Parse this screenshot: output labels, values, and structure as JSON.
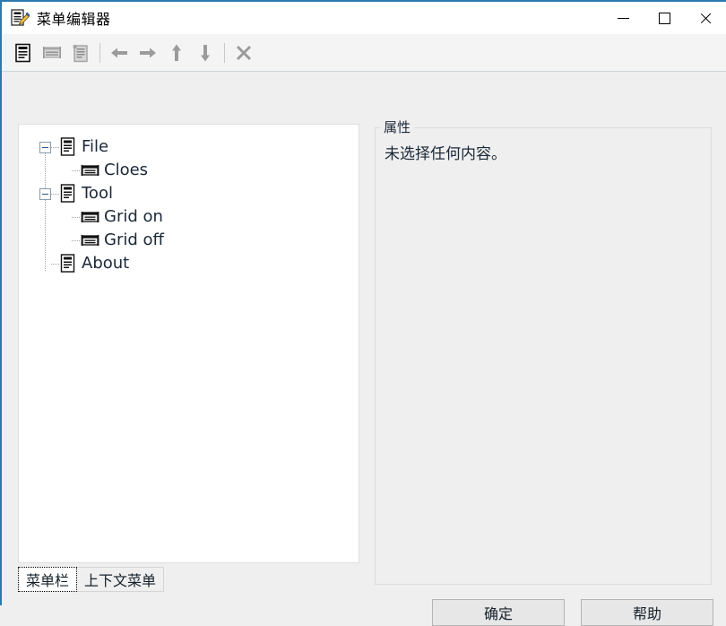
{
  "window": {
    "title": "菜单编辑器",
    "icon": "menu-editor-document-pencil-icon",
    "accent_border_color": "#2a7ab0",
    "controls": {
      "minimize": "—",
      "maximize": "□",
      "close": "✕"
    }
  },
  "toolbar": {
    "items": [
      {
        "name": "new-menu-item-button",
        "icon": "document-lines-icon",
        "enabled": true
      },
      {
        "name": "new-separator-button",
        "icon": "separator-icon",
        "enabled": false
      },
      {
        "name": "new-submenu-button",
        "icon": "document-star-icon",
        "enabled": false
      },
      {
        "name": "move-left-button",
        "icon": "arrow-left-icon",
        "enabled": false
      },
      {
        "name": "move-right-button",
        "icon": "arrow-right-icon",
        "enabled": false
      },
      {
        "name": "move-up-button",
        "icon": "arrow-up-icon",
        "enabled": false
      },
      {
        "name": "move-down-button",
        "icon": "arrow-down-icon",
        "enabled": false
      },
      {
        "name": "delete-button",
        "icon": "close-x-icon",
        "enabled": false
      }
    ]
  },
  "tree": {
    "nodes": [
      {
        "label": "File",
        "level": 0,
        "expandable": true,
        "expanded": true,
        "icon": "menu-document-icon"
      },
      {
        "label": "Cloes",
        "level": 1,
        "expandable": false,
        "expanded": false,
        "icon": "menu-item-bar-icon"
      },
      {
        "label": "Tool",
        "level": 0,
        "expandable": true,
        "expanded": true,
        "icon": "menu-document-icon"
      },
      {
        "label": "Grid on",
        "level": 1,
        "expandable": false,
        "expanded": false,
        "icon": "menu-item-bar-icon"
      },
      {
        "label": "Grid off",
        "level": 1,
        "expandable": false,
        "expanded": false,
        "icon": "menu-item-bar-icon"
      },
      {
        "label": "About",
        "level": 0,
        "expandable": false,
        "expanded": false,
        "icon": "menu-document-icon"
      }
    ]
  },
  "tabs": {
    "items": [
      {
        "label": "菜单栏",
        "selected": true
      },
      {
        "label": "上下文菜单",
        "selected": false
      }
    ]
  },
  "properties": {
    "legend": "属性",
    "empty_message": "未选择任何内容。"
  },
  "dialog_buttons": {
    "ok": "确定",
    "help": "帮助"
  }
}
